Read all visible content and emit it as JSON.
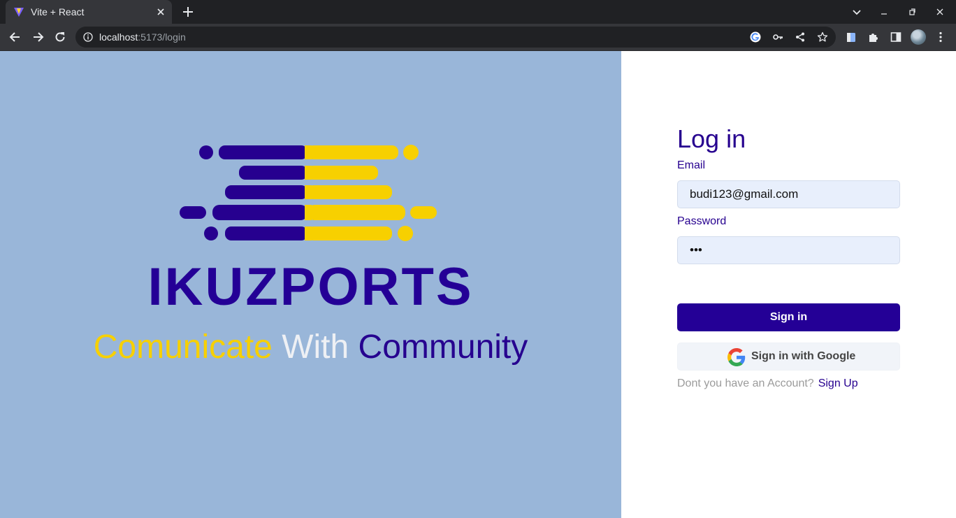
{
  "browser": {
    "tab_title": "Vite + React",
    "url_host": "localhost",
    "url_rest": ":5173/login"
  },
  "icons": {
    "tab_favicon": "vite-icon",
    "tab_close": "close-icon",
    "new_tab": "plus-icon",
    "back": "arrow-left-icon",
    "forward": "arrow-right-icon",
    "reload": "reload-icon",
    "site_info": "info-icon",
    "google": "google-icon",
    "password_key": "key-icon",
    "share": "share-icon",
    "bookmark": "star-icon",
    "extensions": "puzzle-icon",
    "side_panel": "side-panel-icon",
    "menu": "kebab-icon"
  },
  "brand": {
    "name": "IKUZPORTS",
    "tagline_part1": "Comunicate",
    "tagline_part2": "With",
    "tagline_part3": "Community"
  },
  "login": {
    "title": "Log in",
    "email_label": "Email",
    "email_value": "budi123@gmail.com",
    "password_label": "Password",
    "password_value": "•••",
    "signin_label": "Sign in",
    "google_label": "Sign in with Google",
    "signup_prompt": "Dont you have an Account?",
    "signup_link": "Sign Up"
  },
  "colors": {
    "primary": "#240096",
    "accent_yellow": "#f7d000",
    "left_panel_bg": "#99b6d9",
    "input_bg": "#e8effc"
  }
}
